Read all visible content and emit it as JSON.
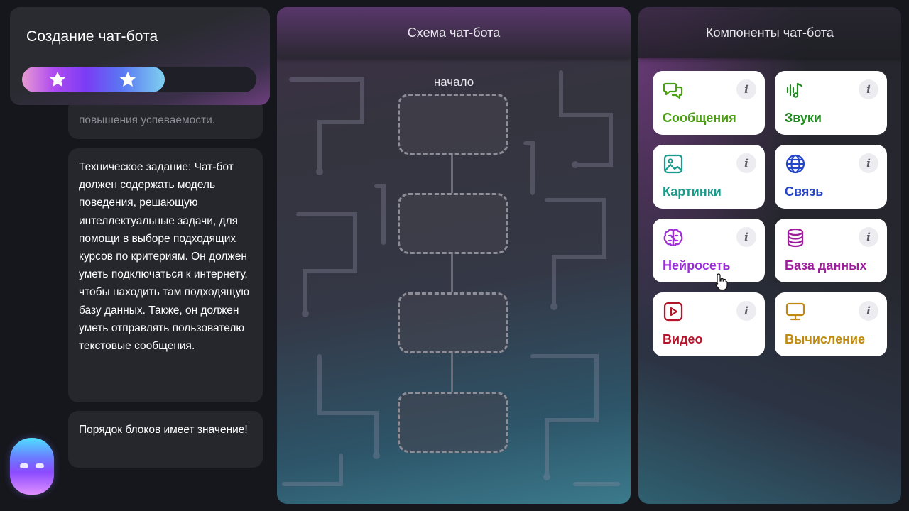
{
  "app": {
    "title": "Создание чат-бота",
    "progress_fraction": 0.61
  },
  "messages": {
    "faded_text": "повышения успеваемости.",
    "task_text": "Техническое задание: Чат-бот должен содержать модель поведения, решающую интеллектуальные задачи, для помощи в выборе подходящих курсов по критериям. Он должен уметь подключаться к интернету, чтобы находить там подходящую базу данных. Также, он должен уметь отправлять пользователю текстовые сообщения.",
    "order_text": "Порядок блоков имеет значение!"
  },
  "scheme": {
    "title": "Схема чат-бота",
    "start_label": "начало",
    "slot_count": 4
  },
  "components": {
    "title": "Компоненты чат-бота",
    "info_glyph": "i",
    "items": [
      {
        "label": "Сообщения",
        "icon": "chat-bubbles-icon",
        "color": "#4a9e12"
      },
      {
        "label": "Звуки",
        "icon": "sound-wave-icon",
        "color": "#1f8a1f"
      },
      {
        "label": "Картинки",
        "icon": "image-icon",
        "color": "#1a9c8c"
      },
      {
        "label": "Связь",
        "icon": "globe-icon",
        "color": "#2545c8"
      },
      {
        "label": "Нейросеть",
        "icon": "brain-icon",
        "color": "#9b2fd6"
      },
      {
        "label": "База данных",
        "icon": "database-icon",
        "color": "#9d1e9a"
      },
      {
        "label": "Видео",
        "icon": "play-video-icon",
        "color": "#b3152a"
      },
      {
        "label": "Вычисление",
        "icon": "computer-icon",
        "color": "#c08a10"
      }
    ]
  }
}
